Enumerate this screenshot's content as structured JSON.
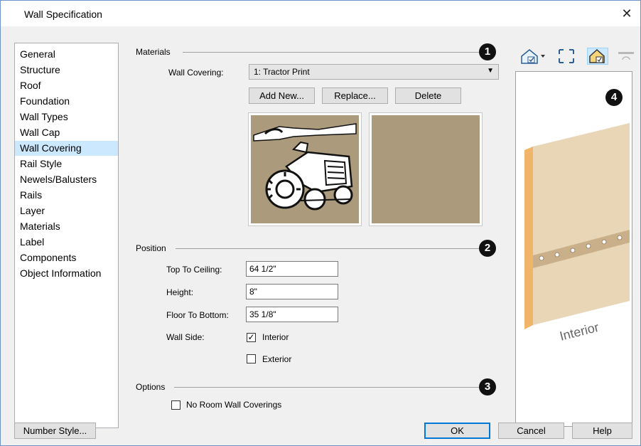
{
  "window": {
    "title": "Wall Specification",
    "close_glyph": "✕"
  },
  "nav": {
    "items": [
      "General",
      "Structure",
      "Roof",
      "Foundation",
      "Wall Types",
      "Wall Cap",
      "Wall Covering",
      "Rail Style",
      "Newels/Balusters",
      "Rails",
      "Layer",
      "Materials",
      "Label",
      "Components",
      "Object Information"
    ],
    "selected": "Wall Covering"
  },
  "materials": {
    "group_label": "Materials",
    "marker": "1",
    "wall_covering_label": "Wall Covering:",
    "wall_covering_value": "1:  Tractor Print",
    "add_new": "Add New...",
    "replace": "Replace...",
    "delete": "Delete"
  },
  "position": {
    "group_label": "Position",
    "marker": "2",
    "top_to_ceiling_label": "Top To Ceiling:",
    "top_to_ceiling": "64 1/2\"",
    "height_label": "Height:",
    "height": "8\"",
    "floor_to_bottom_label": "Floor To Bottom:",
    "floor_to_bottom": "35 1/8\"",
    "wall_side_label": "Wall Side:",
    "interior_label": "Interior",
    "interior_checked": true,
    "exterior_label": "Exterior",
    "exterior_checked": false
  },
  "options": {
    "group_label": "Options",
    "marker": "3",
    "no_room_label": "No Room Wall Coverings",
    "no_room_checked": false
  },
  "preview": {
    "marker": "4",
    "wall_text": "Interior"
  },
  "toolbar": {
    "icons": [
      "preview-mode-icon",
      "fill-window-icon",
      "color-preview-icon",
      "rotate-icon"
    ]
  },
  "footer": {
    "number_style": "Number Style...",
    "ok": "OK",
    "cancel": "Cancel",
    "help": "Help"
  },
  "colors": {
    "selection": "#cce8ff",
    "swatch": "#ab9a7c",
    "default_button_border": "#0078d7"
  }
}
